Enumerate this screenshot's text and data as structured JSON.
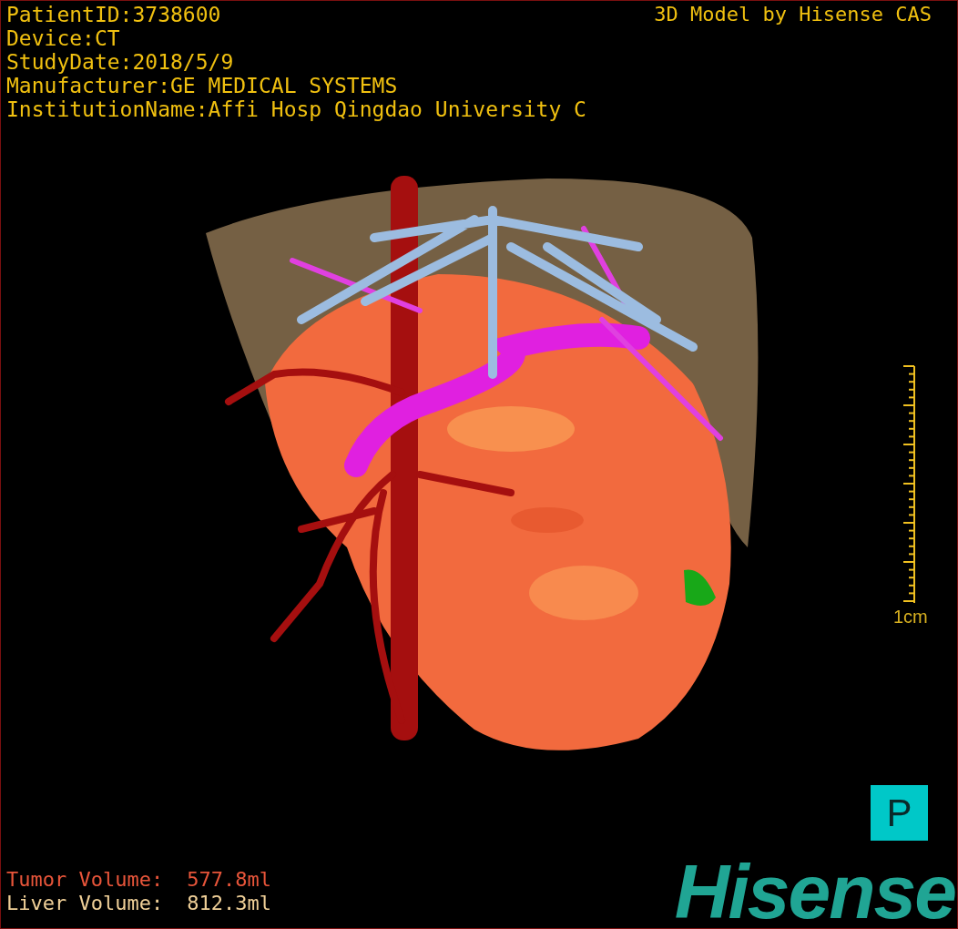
{
  "info_lines": [
    "PatientID:3738600",
    "Device:CT",
    "StudyDate:2018/5/9",
    "Manufacturer:GE MEDICAL SYSTEMS",
    "InstitutionName:Affi Hosp Qingdao University C"
  ],
  "credit": "3D Model by Hisense CAS",
  "scale": {
    "label": "1cm"
  },
  "orientation_marker": {
    "label": "P"
  },
  "volumes": [
    {
      "label": "Tumor Volume:",
      "value": "577.8ml",
      "color": "#e8553a"
    },
    {
      "label": "Liver Volume:",
      "value": "812.3ml",
      "color": "#f0d098"
    }
  ],
  "logo": {
    "text": "Hisense"
  }
}
